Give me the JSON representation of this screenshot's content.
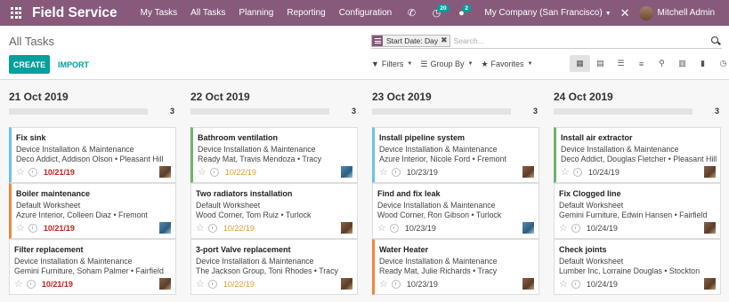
{
  "navbar": {
    "brand": "Field Service",
    "menu": [
      "My Tasks",
      "All Tasks",
      "Planning",
      "Reporting",
      "Configuration"
    ],
    "activity_badge": "20",
    "messages_badge": "2",
    "company": "My Company (San Francisco)",
    "user": "Mitchell Admin"
  },
  "control_panel": {
    "breadcrumb": "All Tasks",
    "create_label": "CREATE",
    "import_label": "IMPORT",
    "facet_label": "Start Date: Day",
    "search_placeholder": "Search...",
    "filters_label": "Filters",
    "groupby_label": "Group By",
    "favorites_label": "Favorites"
  },
  "colors": {
    "brand": "#875a7b",
    "accent": "#00a09d",
    "overdue": "#c0241b",
    "today": "#e89a2b"
  },
  "columns": [
    {
      "title": "21 Oct 2019",
      "count": "3",
      "cards": [
        {
          "title": "Fix sink",
          "project": "Device Installation & Maintenance",
          "customer": "Deco Addict, Addison Olson • Pleasant Hill",
          "date": "10/21/19"
        },
        {
          "title": "Boiler maintenance",
          "project": "Default Worksheet",
          "customer": "Azure Interior, Colleen Diaz • Fremont",
          "date": "10/21/19"
        },
        {
          "title": "Filter replacement",
          "project": "Device Installation & Maintenance",
          "customer": "Gemini Furniture, Soham Palmer • Fairfield",
          "date": "10/21/19"
        }
      ]
    },
    {
      "title": "22 Oct 2019",
      "count": "3",
      "cards": [
        {
          "title": "Bathroom ventilation",
          "project": "Device Installation & Maintenance",
          "customer": "Ready Mat, Travis Mendoza • Tracy",
          "date": "10/22/19"
        },
        {
          "title": "Two radiators installation",
          "project": "Default Worksheet",
          "customer": "Wood Corner, Tom Ruiz • Turlock",
          "date": "10/22/19"
        },
        {
          "title": "3-port Valve replacement",
          "project": "Device Installation & Maintenance",
          "customer": "The Jackson Group, Toni Rhodes • Tracy",
          "date": "10/22/19"
        }
      ]
    },
    {
      "title": "23 Oct 2019",
      "count": "3",
      "cards": [
        {
          "title": "Install pipeline system",
          "project": "Device Installation & Maintenance",
          "customer": "Azure Interior, Nicole Ford • Fremont",
          "date": "10/23/19"
        },
        {
          "title": "Find and fix leak",
          "project": "Device Installation & Maintenance",
          "customer": "Wood Corner, Ron Gibson • Turlock",
          "date": "10/23/19"
        },
        {
          "title": "Water Heater",
          "project": "Device Installation & Maintenance",
          "customer": "Ready Mat, Julie Richards • Tracy",
          "date": "10/23/19"
        }
      ]
    },
    {
      "title": "24 Oct 2019",
      "count": "3",
      "cards": [
        {
          "title": "Install air extractor",
          "project": "Device Installation & Maintenance",
          "customer": "Deco Addict, Douglas Fletcher • Pleasant Hill",
          "date": "10/24/19"
        },
        {
          "title": "Fix Clogged line",
          "project": "Default Worksheet",
          "customer": "Gemini Furniture, Edwin Hansen • Fairfield",
          "date": "10/24/19"
        },
        {
          "title": "Check joints",
          "project": "Default Worksheet",
          "customer": "Lumber Inc, Lorraine Douglas • Stockton",
          "date": "10/24/19"
        }
      ]
    }
  ]
}
